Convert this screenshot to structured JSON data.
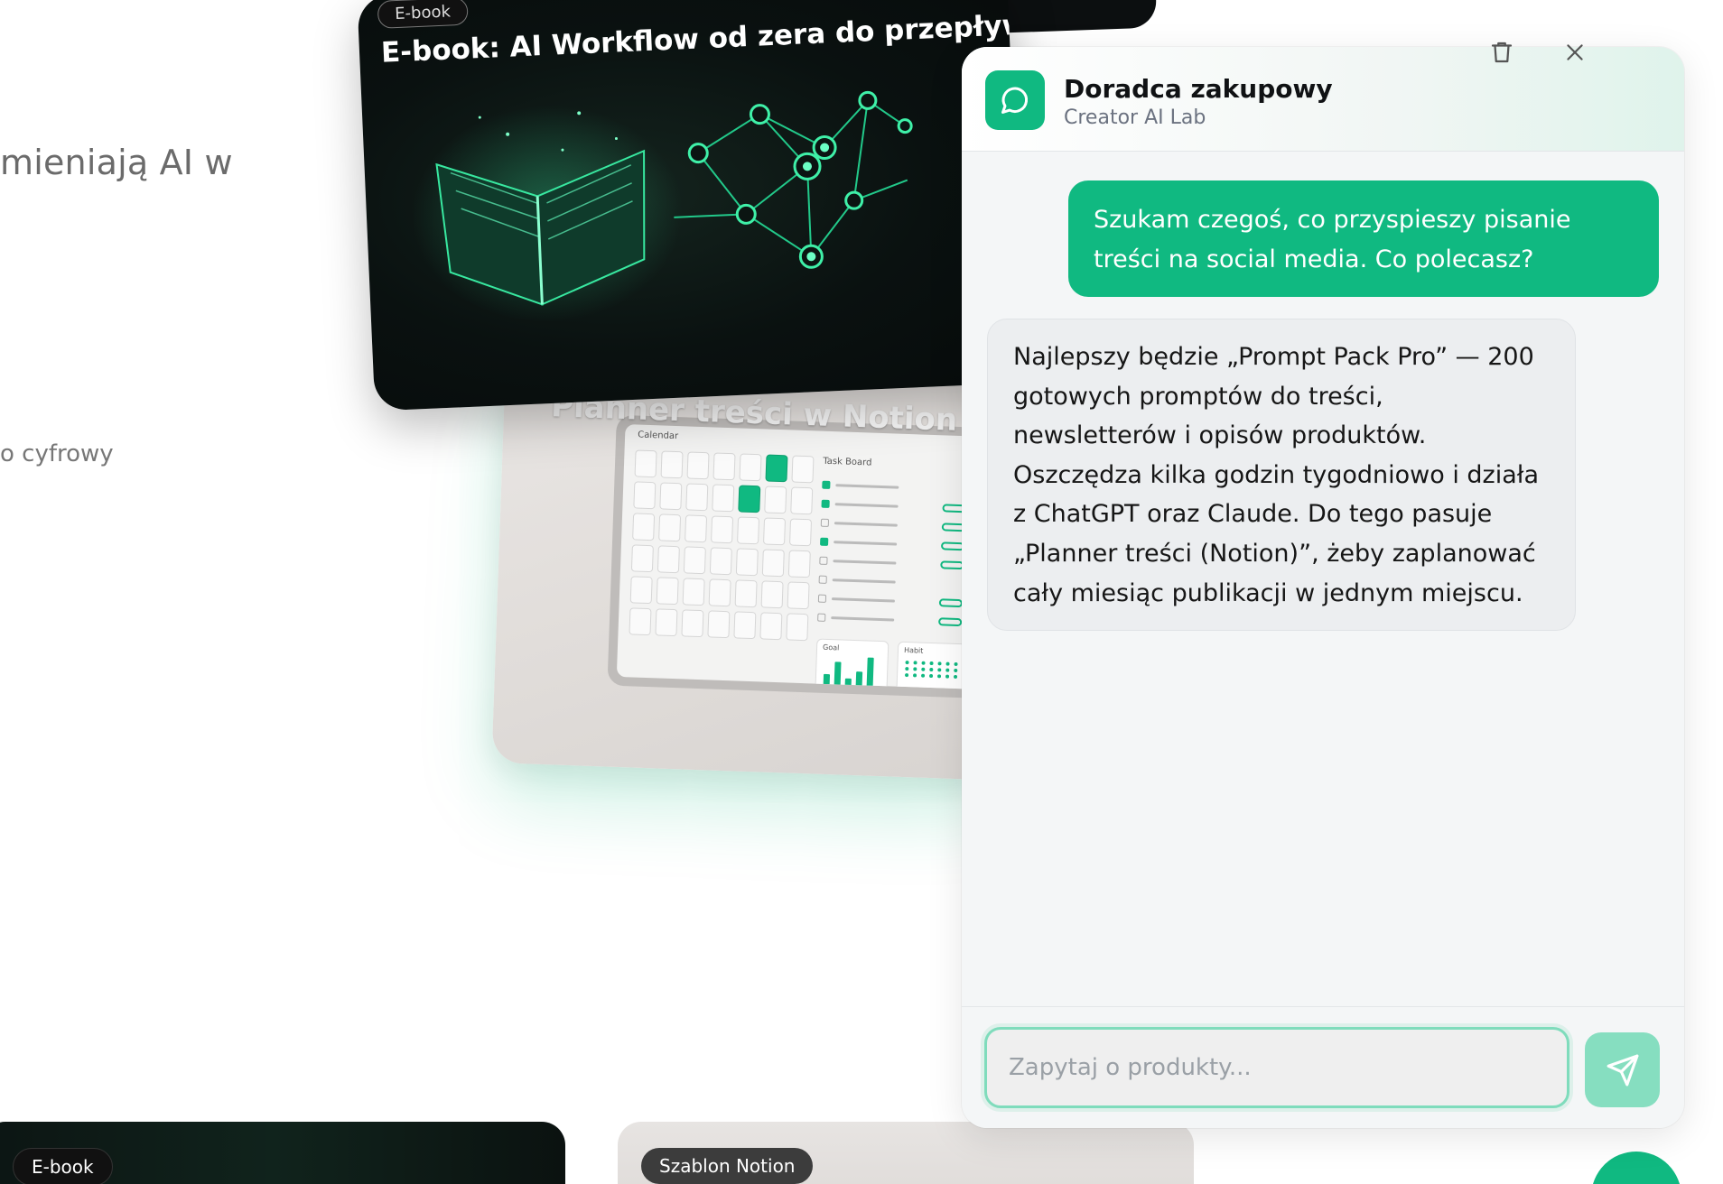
{
  "background": {
    "hero_fragment": "mieniają AI w",
    "sub_fragment": "o cyfrowy"
  },
  "products": {
    "ebook_card": {
      "badge": "E-book",
      "title": "E-book: AI Workflow od zera do przepływu"
    },
    "planner_card": {
      "title": "Planner treści w Notion",
      "screen_labels": {
        "calendar": "Calendar",
        "task_board": "Task Board",
        "goal": "Goal",
        "habit": "Habit"
      }
    },
    "bottom_cards": [
      {
        "badge": "E-book"
      },
      {
        "badge": "Szablon Notion"
      }
    ]
  },
  "chat": {
    "title": "Doradca zakupowy",
    "subtitle": "Creator AI Lab",
    "icons": {
      "avatar": "chat-bubble-icon",
      "trash": "trash-icon",
      "close": "close-icon",
      "send": "send-icon"
    },
    "messages": [
      {
        "role": "user",
        "text": "Szukam czegoś, co przyspieszy pisanie treści na social media. Co polecasz?"
      },
      {
        "role": "assistant",
        "text": "Najlepszy będzie „Prompt Pack Pro” — 200 gotowych promptów do treści, newsletterów i opisów produktów. Oszczędza kilka godzin tygodniowo i działa z ChatGPT oraz Claude. Do tego pasuje „Planner treści (Notion)”, żeby zaplanować cały miesiąc publikacji w jednym miejscu."
      }
    ],
    "input": {
      "value": "",
      "placeholder": "Zapytaj o produkty..."
    }
  },
  "colors": {
    "accent": "#10b981",
    "send_button": "#86dec0",
    "input_border": "#7fdcbc"
  }
}
